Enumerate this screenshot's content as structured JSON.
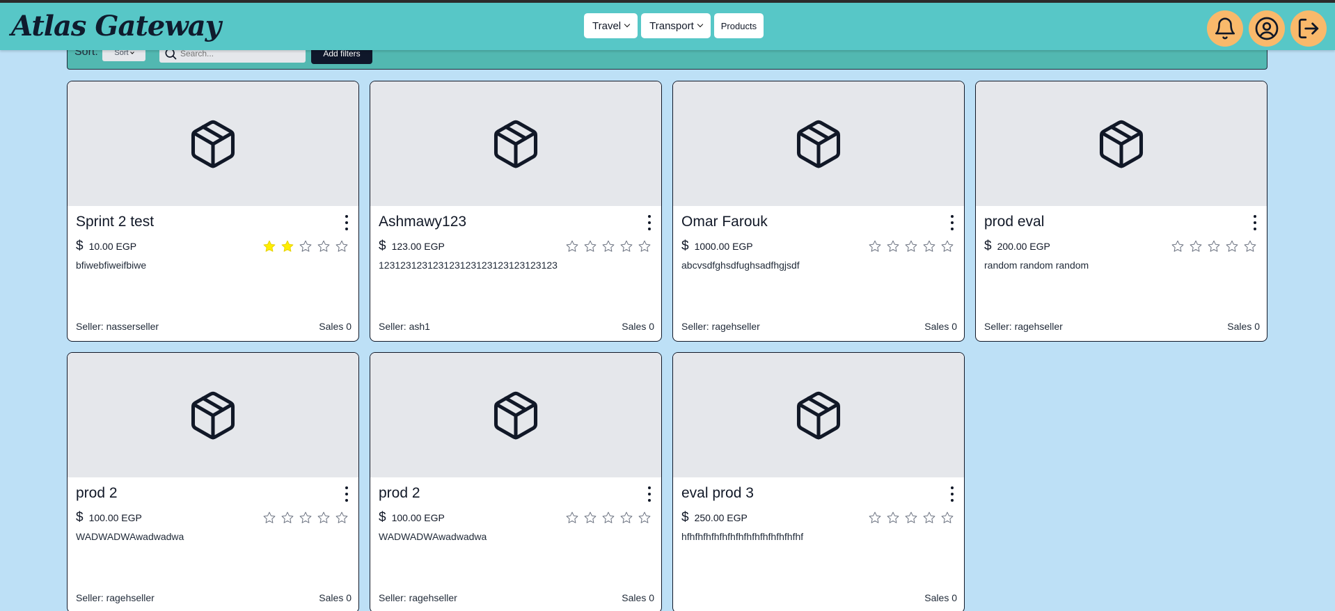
{
  "brand": {
    "logo": "Atlas Gateway"
  },
  "nav": {
    "travel_label": "Travel",
    "transport_label": "Transport",
    "products_label": "Products"
  },
  "header_icons": [
    "bell-icon",
    "user-circle-icon",
    "logout-icon"
  ],
  "filters": {
    "sort_label": "Sort:",
    "sort_value": "Sort",
    "search_placeholder": "Search...",
    "add_filters_label": "Add filters"
  },
  "colors": {
    "navbar": "#57c7c7",
    "filterbar": "#52b8b1",
    "background": "#bde0f6",
    "icon_button": "#f9b96b",
    "star_filled": "#ffee00"
  },
  "products": [
    {
      "name": "Sprint 2 test",
      "currency_icon": "dollar-icon",
      "price": "10.00 EGP",
      "rating": 2,
      "description": "bfiwebfiweifbiwe",
      "seller": "Seller: nasserseller",
      "sales": "Sales 0"
    },
    {
      "name": "Ashmawy123",
      "currency_icon": "dollar-icon",
      "price": "123.00 EGP",
      "rating": 0,
      "description": "123123123123123123123123123123123",
      "seller": "Seller: ash1",
      "sales": "Sales 0"
    },
    {
      "name": "Omar Farouk",
      "currency_icon": "dollar-icon",
      "price": "1000.00 EGP",
      "rating": 0,
      "description": "abcvsdfghsdfughsadfhgjsdf",
      "seller": "Seller: ragehseller",
      "sales": "Sales 0"
    },
    {
      "name": "prod eval",
      "currency_icon": "dollar-icon",
      "price": "200.00 EGP",
      "rating": 0,
      "description": "random random random",
      "seller": "Seller: ragehseller",
      "sales": "Sales 0"
    },
    {
      "name": "prod 2",
      "currency_icon": "dollar-icon",
      "price": "100.00 EGP",
      "rating": 0,
      "description": "WADWADWAwadwadwa",
      "seller": "Seller: ragehseller",
      "sales": "Sales 0"
    },
    {
      "name": "prod 2",
      "currency_icon": "dollar-icon",
      "price": "100.00 EGP",
      "rating": 0,
      "description": "WADWADWAwadwadwa",
      "seller": "Seller: ragehseller",
      "sales": "Sales 0"
    },
    {
      "name": "eval prod 3",
      "currency_icon": "dollar-icon",
      "price": "250.00 EGP",
      "rating": 0,
      "description": "hfhfhfhfhfhfhfhfhfhfhfhfhfhfhf",
      "seller": "",
      "sales": "Sales 0"
    }
  ]
}
